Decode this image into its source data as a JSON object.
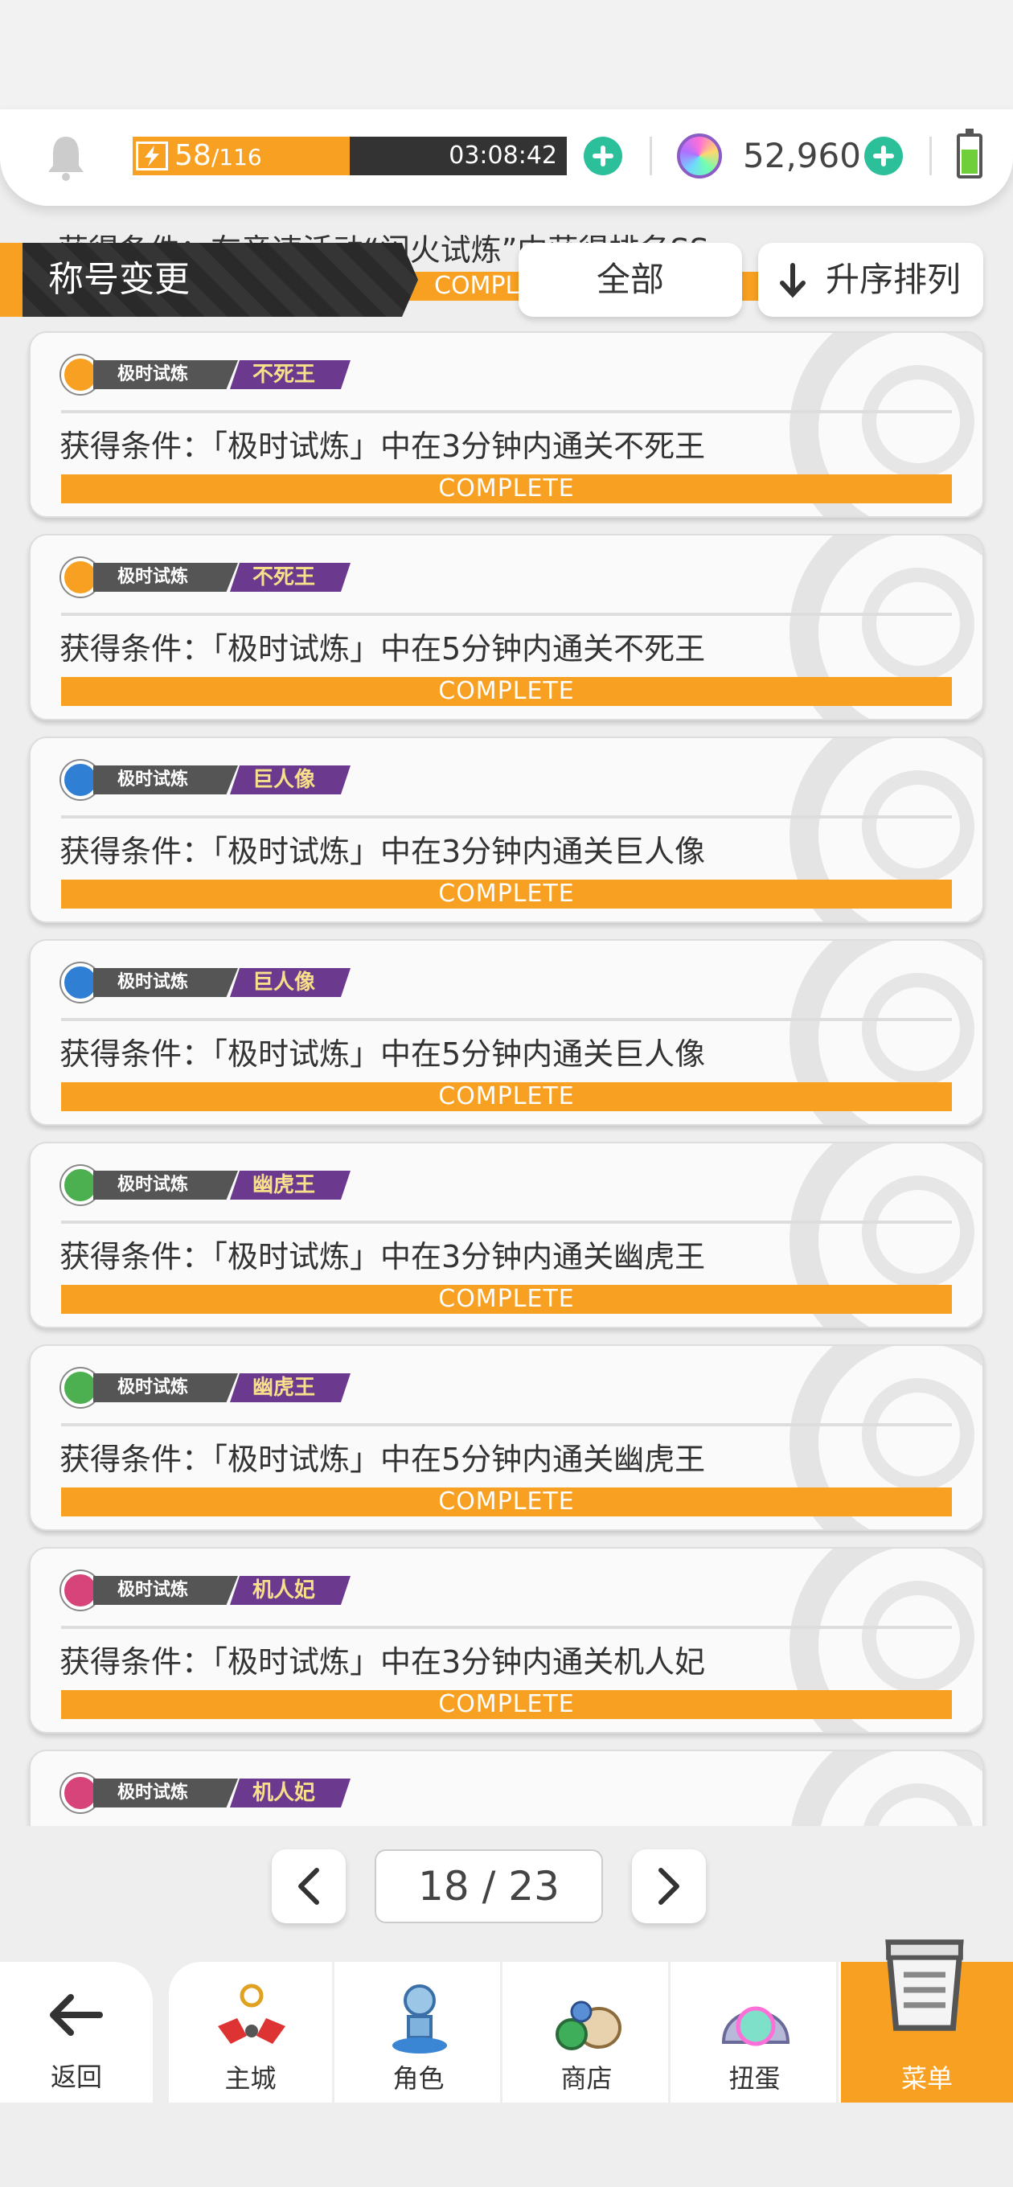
{
  "status": {
    "stamina_current": "58",
    "stamina_max": "/116",
    "stamina_fraction": 0.5,
    "timer": "03:08:42",
    "gems": "52,960",
    "icons": [
      "bell-icon",
      "bolt-icon",
      "plus-icon",
      "gem-icon",
      "battery-icon"
    ]
  },
  "header": {
    "title": "称号变更",
    "filter_label": "全部",
    "sort_label": "升序排列"
  },
  "partial_card": {
    "condition": "获得条件：在竞速活动“闪火试炼”中获得排名SS",
    "status": "COMPLETE"
  },
  "cards": [
    {
      "tag": "极时试炼",
      "boss": "不死王",
      "medal_color": "#f7a021",
      "condition": "获得条件：「极时试炼」中在3分钟内通关不死王",
      "status": "COMPLETE"
    },
    {
      "tag": "极时试炼",
      "boss": "不死王",
      "medal_color": "#f7a021",
      "condition": "获得条件：「极时试炼」中在5分钟内通关不死王",
      "status": "COMPLETE"
    },
    {
      "tag": "极时试炼",
      "boss": "巨人像",
      "medal_color": "#2f7fd4",
      "condition": "获得条件：「极时试炼」中在3分钟内通关巨人像",
      "status": "COMPLETE"
    },
    {
      "tag": "极时试炼",
      "boss": "巨人像",
      "medal_color": "#2f7fd4",
      "condition": "获得条件：「极时试炼」中在5分钟内通关巨人像",
      "status": "COMPLETE"
    },
    {
      "tag": "极时试炼",
      "boss": "幽虎王",
      "medal_color": "#4caf50",
      "condition": "获得条件：「极时试炼」中在3分钟内通关幽虎王",
      "status": "COMPLETE"
    },
    {
      "tag": "极时试炼",
      "boss": "幽虎王",
      "medal_color": "#4caf50",
      "condition": "获得条件：「极时试炼」中在5分钟内通关幽虎王",
      "status": "COMPLETE"
    },
    {
      "tag": "极时试炼",
      "boss": "机人妃",
      "medal_color": "#d6447a",
      "condition": "获得条件：「极时试炼」中在3分钟内通关机人妃",
      "status": "COMPLETE"
    },
    {
      "tag": "极时试炼",
      "boss": "机人妃",
      "medal_color": "#d6447a",
      "condition": "",
      "status": ""
    }
  ],
  "pager": {
    "page": "18 / 23"
  },
  "nav": {
    "back": "返回",
    "items": [
      {
        "label": "主城",
        "icon": "castle-icon"
      },
      {
        "label": "角色",
        "icon": "character-icon"
      },
      {
        "label": "商店",
        "icon": "shop-icon"
      },
      {
        "label": "扭蛋",
        "icon": "gacha-icon"
      },
      {
        "label": "菜单",
        "icon": "menu-icon"
      }
    ]
  },
  "colors": {
    "accent": "#f7a021",
    "plus": "#2bbf9a",
    "title_tag": "#6b3a8f"
  }
}
